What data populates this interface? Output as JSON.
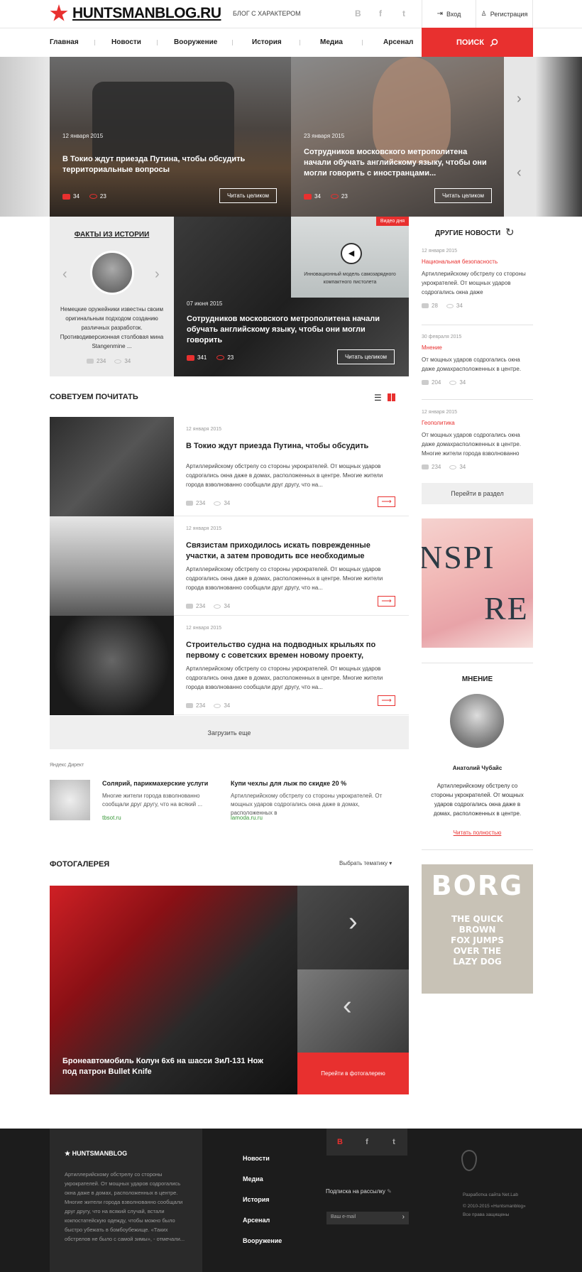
{
  "header": {
    "logo_text": "HUNTSMANBLOG.RU",
    "tagline": "БЛОГ С ХАРАКТЕРОМ",
    "social": [
      "В",
      "f",
      "t"
    ],
    "login_label": "Вход",
    "register_label": "Регистрация",
    "search_label": "ПОИСК",
    "nav": [
      "Главная",
      "Новости",
      "Вооружение",
      "История",
      "Медиа",
      "Арсенал"
    ]
  },
  "hero": {
    "slides": [
      {
        "date": "12 января 2015",
        "title": "В Токио ждут приезда Путина, чтобы обсудить территориальные вопросы",
        "comments": "34",
        "views": "23",
        "button": "Читать целиком"
      },
      {
        "date": "23 января 2015",
        "title": "Сотрудников московского метрополитена начали обучать английскому языку, чтобы они могли говорить с иностранцами...",
        "comments": "34",
        "views": "23",
        "button": "Читать целиком"
      }
    ]
  },
  "facts": {
    "title": "ФАКТЫ ИЗ ИСТОРИИ",
    "text": "Немецкие оружейники известны своим оригинальным подходом созданию различных разработок. Противодиверсионная столбовая мина Stangenmine ...",
    "comments": "234",
    "views": "34"
  },
  "video": {
    "badge": "Видео дня",
    "caption": "Инновационный модель самозарядного компактного пистолета"
  },
  "feature": {
    "date": "07 июня 2015",
    "title": "Сотрудников московского метрополитена начали обучать английскому языку, чтобы они могли говорить",
    "comments": "341",
    "views": "23",
    "button": "Читать целиком"
  },
  "other_news": {
    "title": "ДРУГИЕ НОВОСТИ",
    "items": [
      {
        "date": "12 января 2015",
        "category": "Национальная безопасность",
        "text": "Артиллерийскому обстрелу со стороны укрократелей. От мощных ударов содрогались окна даже",
        "comments": "28",
        "views": "34"
      },
      {
        "date": "30 февраля 2015",
        "category": "Мнение",
        "text": "От мощных ударов содрогались окна даже домахрасположенных в центре.",
        "comments": "204",
        "views": "34"
      },
      {
        "date": "12 января 2015",
        "category": "Геополитика",
        "text": "От мощных ударов содрогались окна даже домахрасположенных в центре. Многие жители города взволнованно",
        "comments": "234",
        "views": "34"
      }
    ],
    "button": "Перейти в раздел"
  },
  "recommend": {
    "title": "СОВЕТУЕМ ПОЧИТАТЬ",
    "articles": [
      {
        "date": "12 января 2015",
        "title": "В Токио ждут приезда Путина, чтобы обсудить",
        "text": "Артиллерийскому обстрелу со стороны укрократелей. От мощных ударов содрогались окна даже в домах, расположенных в центре. Многие жители города взволнованно сообщали друг другу, что на...",
        "comments": "234",
        "views": "34"
      },
      {
        "date": "12 января 2015",
        "title": "Связистам приходилось искать поврежденные участки, а затем проводить все необходимые",
        "text": "Артиллерийскому обстрелу со стороны укрократелей. От мощных ударов содрогались окна даже в домах, расположенных в центре. Многие жители города взволнованно сообщали друг другу, что на...",
        "comments": "234",
        "views": "34"
      },
      {
        "date": "12 января 2015",
        "title": "Строительство судна на подводных крыльях по первому с советских времен новому проекту,",
        "text": "Артиллерийскому обстрелу со стороны укрократелей. От мощных ударов содрогались окна даже в домах, расположенных в центре. Многие жители города взволнованно сообщали друг другу, что на...",
        "comments": "234",
        "views": "34"
      }
    ],
    "load_more": "Загрузить еще"
  },
  "ads": {
    "label": "Яндекс Директ",
    "items": [
      {
        "title": "Солярий, парикмахерские услуги",
        "text": "Многие жители города взволнованно сообщали друг другу, что на всякий ...",
        "url": "tbsot.ru"
      },
      {
        "title": "Купи чехлы для лыж по скидке 20 %",
        "text": "Артиллерийскому обстрелу со стороны укрократелей. От мощных ударов содрогались окна даже в домах, расположенных в",
        "url": "lamoda.ru.ru"
      }
    ]
  },
  "opinion": {
    "title": "МНЕНИЕ",
    "name": "Анатолий Чубайс",
    "text": "Артиллерийскому обстрелу со стороны укрократелей. От мощных ударов содрогались окна даже в домах, расположенных в центре.",
    "link": "Читать полностью"
  },
  "banners": {
    "inspire_lines": [
      "NSPI",
      "RE"
    ],
    "borg_title": "BORG",
    "borg_text": "THE QUICK BROWN FOX JUMPS OVER THE LAZY DOG"
  },
  "gallery": {
    "title": "ФОТОГАЛЕРЕЯ",
    "filter": "Выбрать тематику",
    "caption": "Бронеавтомобиль Колун 6х6 на шасси ЗиЛ-131 Нож под патрон Bullet Knife",
    "button": "Перейти в фотогалерею"
  },
  "footer": {
    "logo": "HUNTSMANBLOG",
    "text": "Артиллерийскому обстрелу со стороны укрократелей. От мощных ударов содрогались окна даже в домах, расположенных в центре. Многие жители города взволнованно сообщали друг другу, что на всякий случай, встали кокпостатейскую одежду, чтобы можно было быстро убежать в бомбоубежище. «Таких обстрелов не было с самой зимы», - отмечали...",
    "links": [
      "Новости",
      "Медиа",
      "История",
      "Арсенал",
      "Вооружение"
    ],
    "subscribe_label": "Подписка на рассылку",
    "email_placeholder": "Ваш e-mail",
    "social": [
      "В",
      "f",
      "t"
    ],
    "dev": "Разработка сайта Net.Lab",
    "copyright": "© 2010-2015 «Huntsmanblog»",
    "rights": "Все права защищены"
  }
}
